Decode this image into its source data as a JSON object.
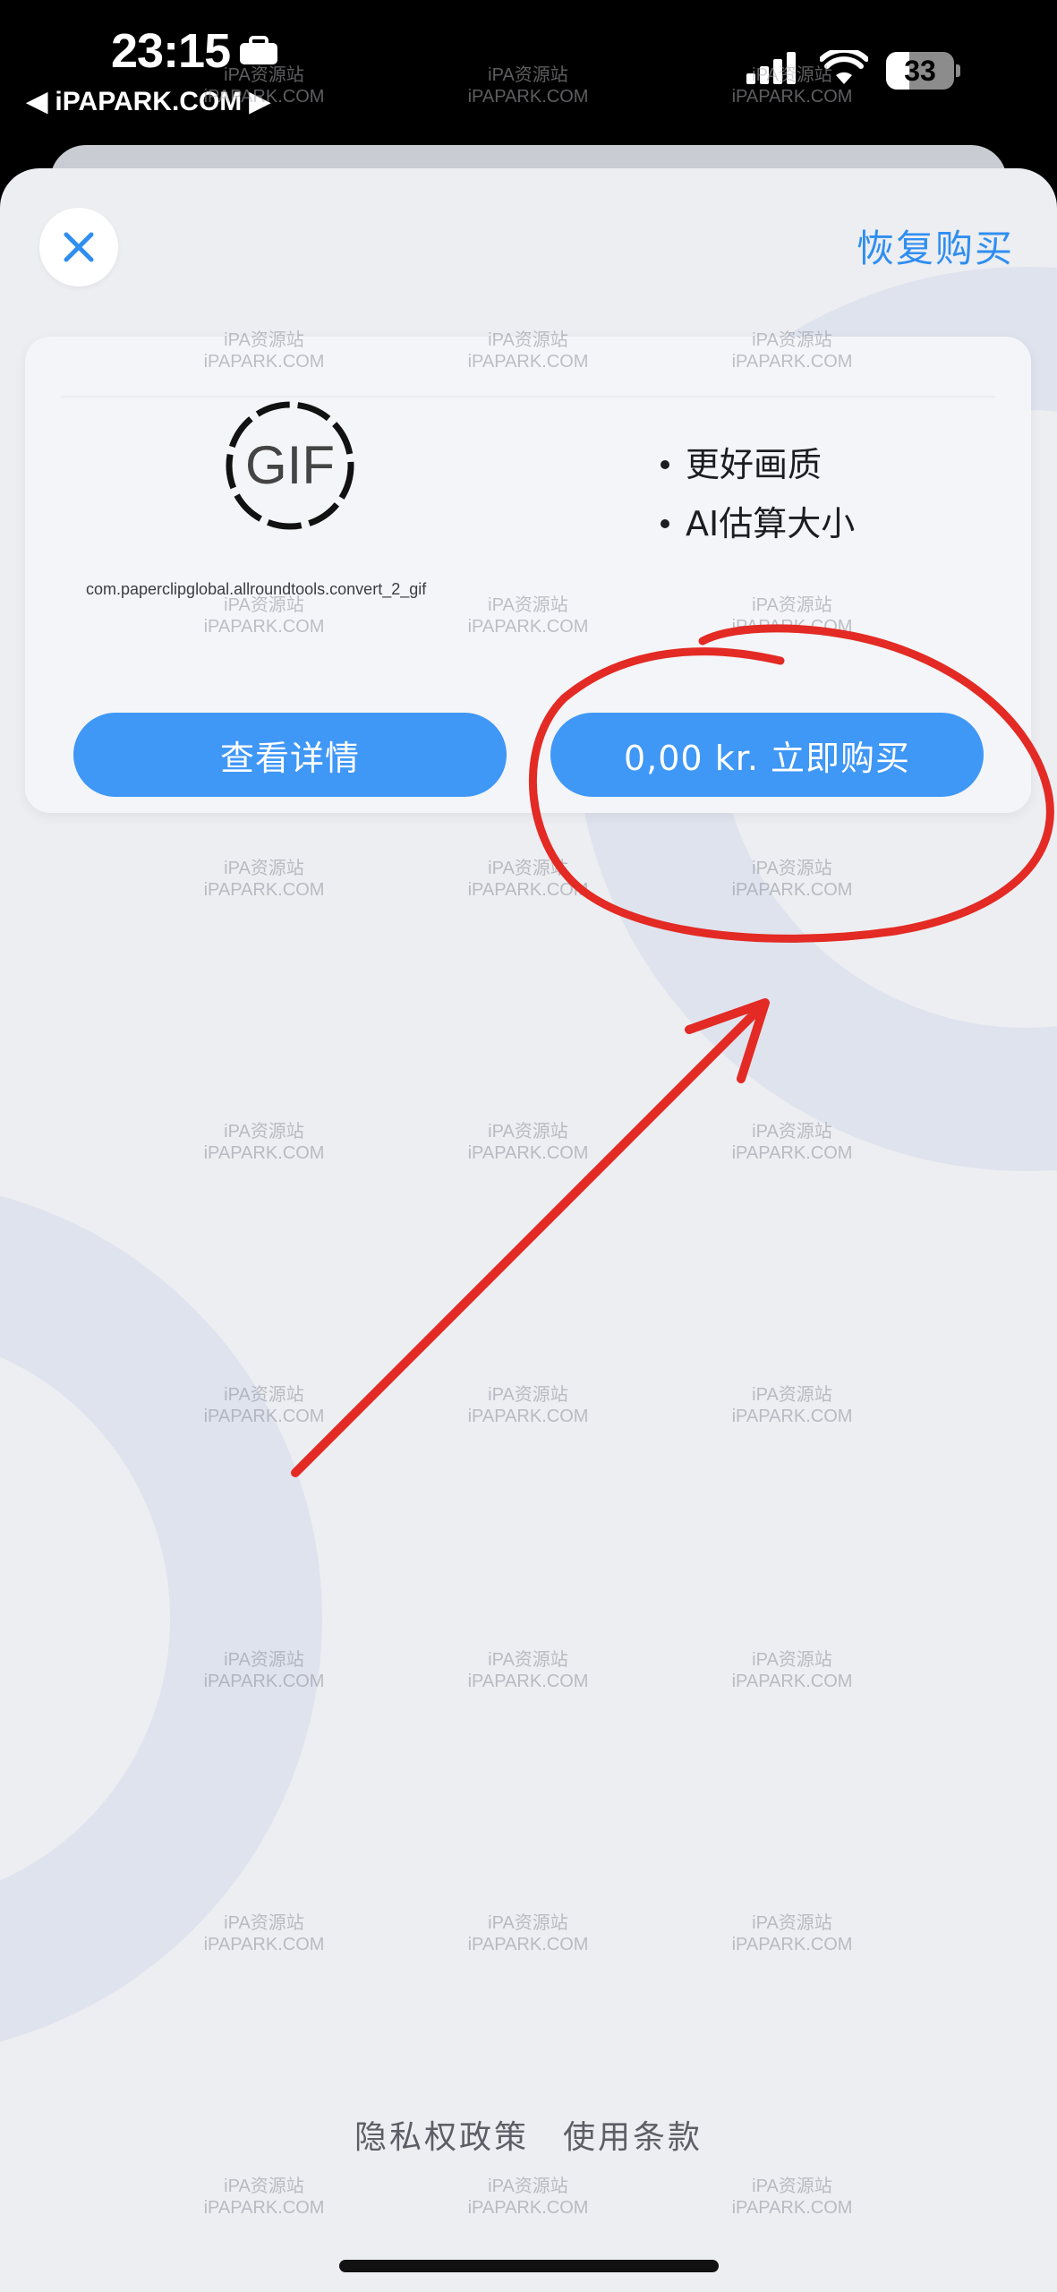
{
  "status_bar": {
    "time": "23:15",
    "back_label": "◀ iPAPARK.COM ▶",
    "battery": "33",
    "icons": [
      "suitcase-icon",
      "signal-icon",
      "wifi-icon",
      "battery-icon"
    ]
  },
  "header": {
    "close_icon": "close-icon",
    "restore_label": "恢复购买"
  },
  "product": {
    "logo_text": "GIF",
    "product_id": "com.paperclipglobal.allroundtools.convert_2_gif",
    "features": [
      "更好画质",
      "AI估算大小"
    ],
    "details_button": "查看详情",
    "buy_button": "0,00 kr. 立即购买"
  },
  "footer": {
    "privacy": "隐私权政策",
    "terms": "使用条款"
  },
  "watermark": {
    "line1": "iPA资源站",
    "line2": "iPAPARK.COM"
  },
  "colors": {
    "accent": "#3f97f6",
    "link": "#2f8ef0",
    "annotation": "#e32a24",
    "background": "#edeef1"
  }
}
